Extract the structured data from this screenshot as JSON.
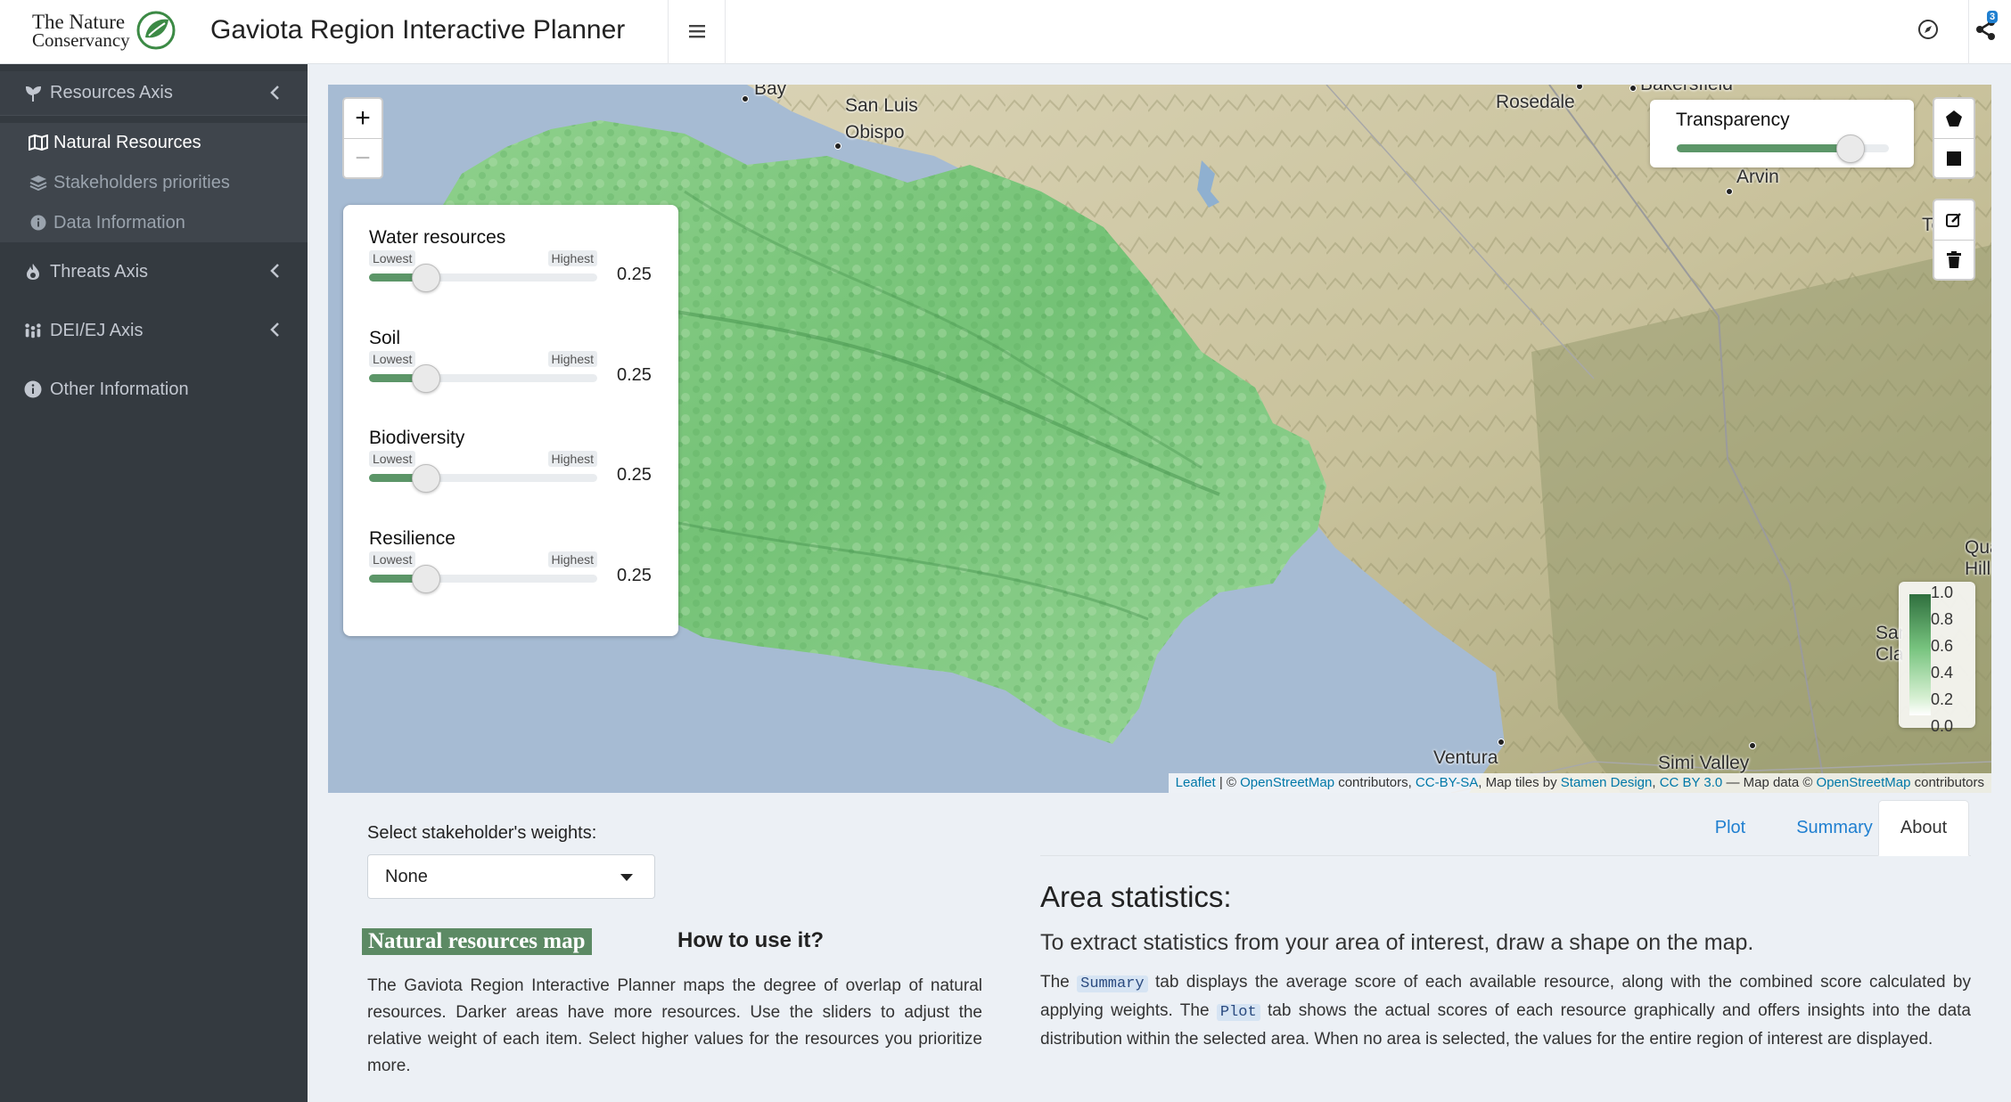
{
  "brand": {
    "line1": "The Nature",
    "line2": "Conservancy"
  },
  "header": {
    "title": "Gaviota Region Interactive Planner",
    "notification_count": "3"
  },
  "sidebar": {
    "resources_axis": "Resources Axis",
    "sub_items": [
      "Natural Resources",
      "Stakeholders priorities",
      "Data Information"
    ],
    "threats_axis": "Threats Axis",
    "dei_axis": "DEI/EJ Axis",
    "other_info": "Other Information"
  },
  "map": {
    "zoom_in": "+",
    "zoom_out": "−",
    "places": [
      "Bay",
      "San Luis",
      "Obispo",
      "Rosedale",
      "Bakersfield",
      "Arvin",
      "Tehachapi",
      "Ventura",
      "Simi Valley",
      "Santa Clarita",
      "Quartz Hill"
    ],
    "transparency": {
      "label": "Transparency",
      "value": 0.82
    },
    "legend_ticks": [
      "1.0",
      "0.8",
      "0.6",
      "0.4",
      "0.2",
      "0.0"
    ],
    "attribution": {
      "leaflet": "Leaflet",
      "sep1": " | © ",
      "osm": "OpenStreetMap",
      "t1": " contributors, ",
      "ccbysa": "CC-BY-SA",
      "t2": ", Map tiles by ",
      "stamen": "Stamen Design",
      "t3": ", ",
      "ccby": "CC BY 3.0",
      "t4": " — Map data © ",
      "osm2": "OpenStreetMap",
      "t5": " contributors"
    }
  },
  "weights": {
    "min_label": "Lowest",
    "max_label": "Highest",
    "items": [
      {
        "label": "Water resources",
        "value": "0.25",
        "fraction": 0.25
      },
      {
        "label": "Soil",
        "value": "0.25",
        "fraction": 0.25
      },
      {
        "label": "Biodiversity",
        "value": "0.25",
        "fraction": 0.25
      },
      {
        "label": "Resilience",
        "value": "0.25",
        "fraction": 0.25
      }
    ]
  },
  "stakeholder": {
    "label": "Select stakeholder's weights:",
    "selected": "None"
  },
  "natural": {
    "badge": "Natural resources map",
    "how_title": "How to use it?",
    "description": "The Gaviota Region Interactive Planner maps the degree of overlap of natural resources. Darker areas have more resources. Use the sliders to adjust the relative weight of each item. Select higher values for the resources you prioritize more."
  },
  "tabs": {
    "plot": "Plot",
    "summary": "Summary",
    "about": "About"
  },
  "area": {
    "title": "Area statistics:",
    "subtitle": "To extract statistics from your area of interest, draw a shape on the map.",
    "p1": "The ",
    "kw_summary": "Summary",
    "p2": " tab displays the average score of each available resource, along with the combined score calculated by applying weights. The ",
    "kw_plot": "Plot",
    "p3": " tab shows the actual scores of each resource graphically and offers insights into the data distribution within the selected area. When no area is selected, the values for the entire region of interest are displayed."
  },
  "colors": {
    "sidebar": "#343a40",
    "accent_green": "#5c9668",
    "link_blue": "#1f7fd0",
    "ocean": "#a6bbd3"
  }
}
